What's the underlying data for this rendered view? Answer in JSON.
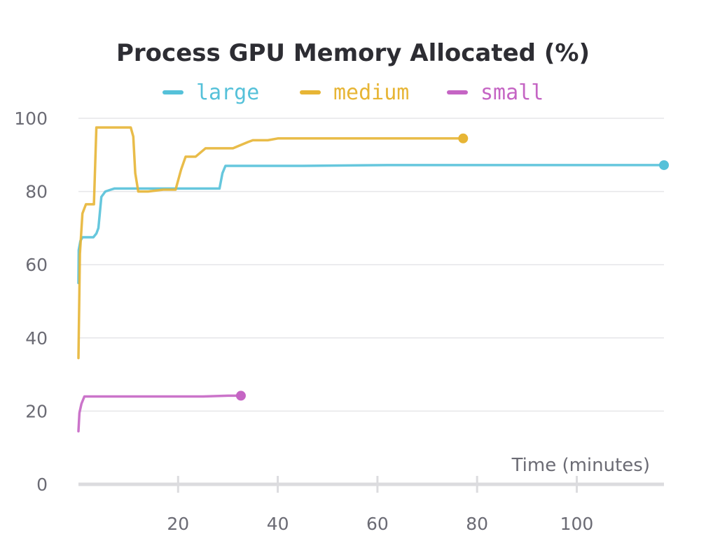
{
  "chart_data": {
    "type": "line",
    "title": "Process GPU Memory Allocated (%)",
    "xlabel": "Time (minutes)",
    "ylabel": "",
    "xlim": [
      0,
      117.5
    ],
    "ylim": [
      0,
      100
    ],
    "x_ticks": [
      20,
      40,
      60,
      80,
      100
    ],
    "y_ticks": [
      0,
      20,
      40,
      60,
      80,
      100
    ],
    "grid": true,
    "legend_position": "top-center",
    "series": [
      {
        "name": "large",
        "color": "#55c1d9",
        "x": [
          0,
          0.05,
          0.4,
          0.8,
          3.0,
          3.6,
          4.0,
          4.6,
          5.4,
          6.5,
          7.2,
          12,
          20,
          28.3,
          28.9,
          29.5,
          45,
          62,
          80,
          100,
          117.5
        ],
        "y": [
          55,
          64,
          66.5,
          67.5,
          67.5,
          68.5,
          70,
          78.5,
          80,
          80.5,
          80.8,
          80.8,
          80.8,
          80.8,
          85,
          87,
          87,
          87.2,
          87.2,
          87.2,
          87.2
        ]
      },
      {
        "name": "medium",
        "color": "#e7b535",
        "x": [
          0,
          0.3,
          0.8,
          1.5,
          2.2,
          3.1,
          3.6,
          4.0,
          10.5,
          11.0,
          11.4,
          12,
          14,
          17,
          19.5,
          20.6,
          21.5,
          23.5,
          25.5,
          26.5,
          31,
          34,
          35,
          38,
          40,
          50,
          60,
          70,
          77.2
        ],
        "y": [
          34.5,
          63,
          74,
          76.5,
          76.5,
          76.5,
          97.5,
          97.5,
          97.5,
          95,
          85,
          80,
          80,
          80.5,
          80.5,
          86,
          89.5,
          89.5,
          91.8,
          91.8,
          91.8,
          93.5,
          94,
          94,
          94.5,
          94.5,
          94.5,
          94.5,
          94.5
        ]
      },
      {
        "name": "small",
        "color": "#c565c4",
        "x": [
          0,
          0.2,
          0.6,
          1.2,
          5,
          10,
          15,
          20,
          25,
          30,
          32.6
        ],
        "y": [
          14.5,
          19.5,
          22,
          24,
          24,
          24,
          24,
          24,
          24,
          24.2,
          24.2
        ]
      }
    ]
  }
}
